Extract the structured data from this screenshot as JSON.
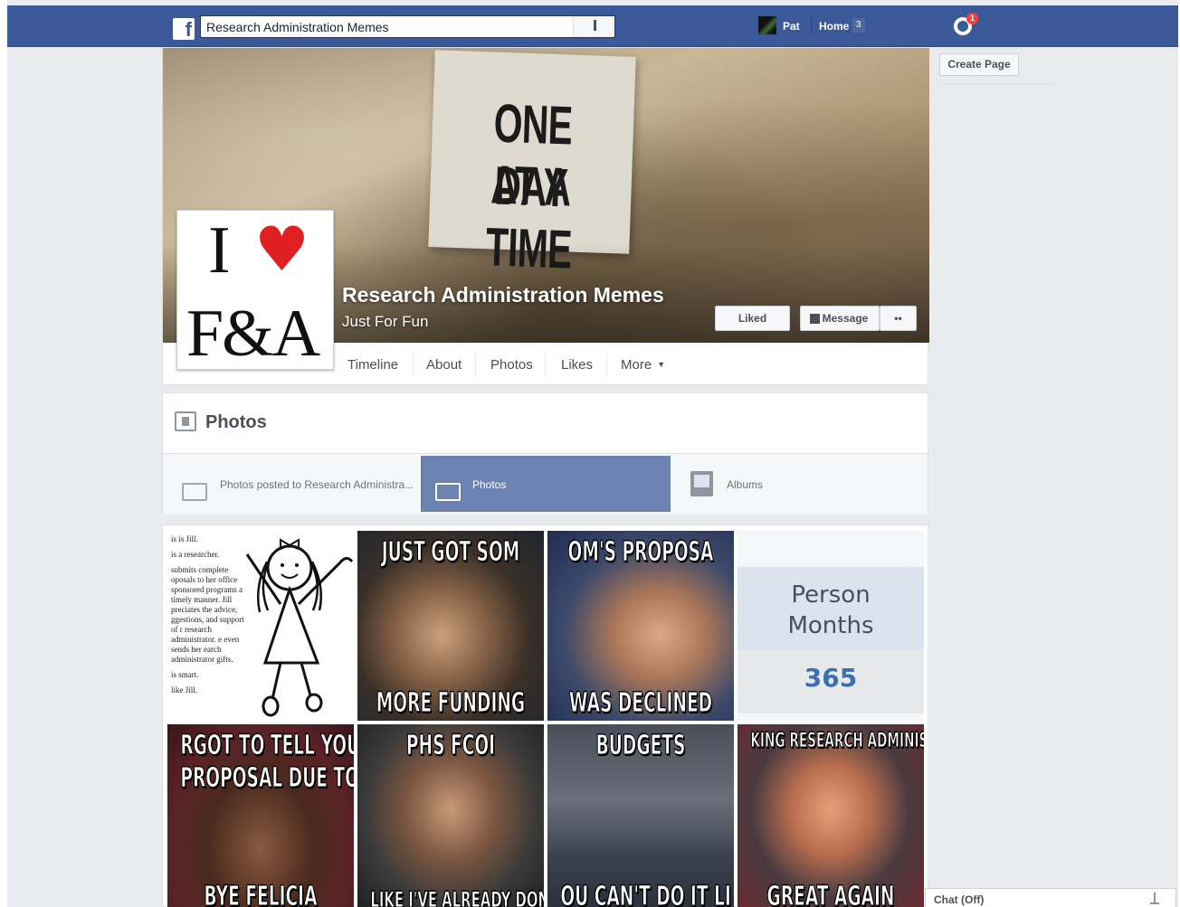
{
  "topbar": {
    "logo": "f",
    "search_value": "Research Administration Memes",
    "user_name": "Pat",
    "home_label": "Home",
    "home_count": "3",
    "notifications_count": "1"
  },
  "cover": {
    "sign_line1": "ONE DAY",
    "sign_line2": "AT A TIME",
    "page_name": "Research Administration Memes",
    "category": "Just For Fun",
    "liked_label": "Liked",
    "message_label": "Message",
    "more_label": "••"
  },
  "profile_pic": {
    "line1_i": "I",
    "line1_heart": "♥",
    "line2": "F&A"
  },
  "tabs": [
    {
      "label": "Timeline"
    },
    {
      "label": "About"
    },
    {
      "label": "Photos"
    },
    {
      "label": "Likes"
    },
    {
      "label": "More"
    }
  ],
  "photos": {
    "title": "Photos",
    "subtabs": [
      {
        "label": "Photos posted to Research Administra..."
      },
      {
        "label": "Photos"
      },
      {
        "label": "Albums"
      }
    ]
  },
  "grid": {
    "tile1": {
      "lines": [
        "is is Jill.",
        "is a researcher.",
        "submits complete oposals to her office sponsored programs a timely manner. Jill preciates the advice, ggestions, and support of r research administrator. e even sends her earch administrator gifts.",
        "is smart.",
        "like Jill."
      ]
    },
    "tile2": {
      "top": "JUST GOT SOM",
      "bottom": "MORE FUNDING"
    },
    "tile3": {
      "top": "OM'S PROPOSA",
      "bottom": "WAS DECLINED"
    },
    "tile4": {
      "label_line1": "Person",
      "label_line2": "Months",
      "value": "365"
    },
    "tile5": {
      "top": "RGOT TO TELL YOU I HA",
      "mid": "PROPOSAL DUE TODAY",
      "bottom": "BYE FELICIA"
    },
    "tile6": {
      "top": "PHS FCOI",
      "bottom": "LIKE I'VE ALREADY DONE"
    },
    "tile7": {
      "top": "BUDGETS",
      "bottom": "OU CAN'T DO IT LI"
    },
    "tile8": {
      "top": "KING RESEARCH ADMINISTRAT",
      "bottom": "GREAT AGAIN"
    }
  },
  "sidebar": {
    "create_page_label": "Create Page"
  },
  "chat": {
    "label": "Chat (Off)"
  },
  "colors": {
    "brand": "#3b5998",
    "active_subtab": "#6c83b1",
    "badge": "#fa3e3e"
  }
}
